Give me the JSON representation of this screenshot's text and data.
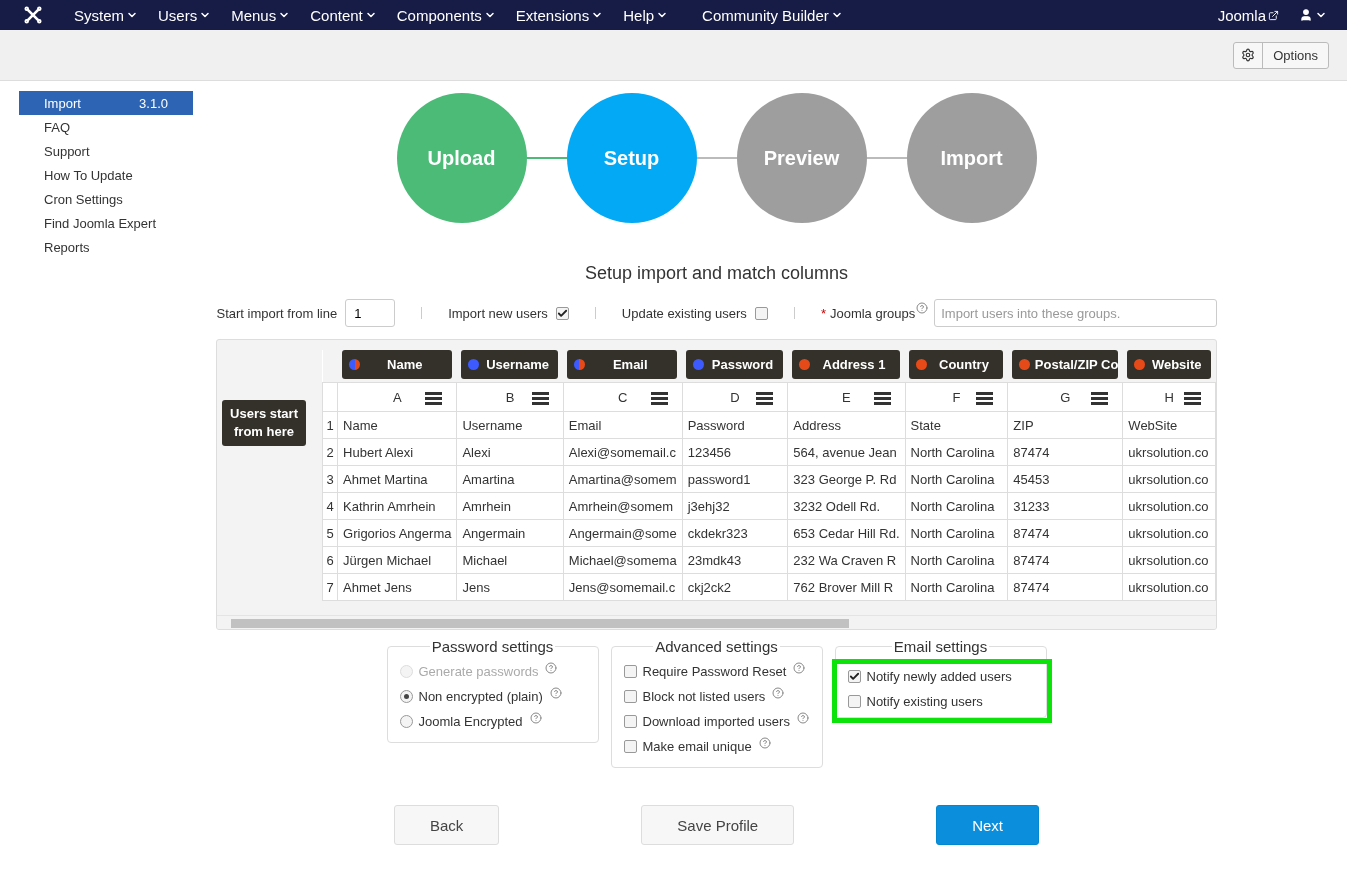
{
  "navbar": {
    "menus": [
      "System",
      "Users",
      "Menus",
      "Content",
      "Components",
      "Extensions",
      "Help",
      "Community Builder"
    ],
    "site_link": "Joomla"
  },
  "toolbar": {
    "options_button": "Options"
  },
  "sidebar": {
    "items": [
      {
        "label": "Import",
        "version": "3.1.0",
        "selected": true
      },
      {
        "label": "FAQ",
        "selected": false
      },
      {
        "label": "Support",
        "selected": false
      },
      {
        "label": "How To Update",
        "selected": false
      },
      {
        "label": "Cron Settings",
        "selected": false
      },
      {
        "label": "Find Joomla Expert",
        "selected": false
      },
      {
        "label": "Reports",
        "selected": false
      }
    ]
  },
  "steps": [
    {
      "label": "Upload",
      "completed": true,
      "selected": false
    },
    {
      "label": "Setup",
      "completed": false,
      "selected": true
    },
    {
      "label": "Preview",
      "completed": false,
      "selected": false
    },
    {
      "label": "Import",
      "completed": false,
      "selected": false
    }
  ],
  "heading": "Setup import and match columns",
  "options": {
    "start_line_label": "Start import from line",
    "start_line_value": "1",
    "import_new_label": "Import new users",
    "import_new_checked": true,
    "update_existing_label": "Update existing users",
    "update_existing_checked": false,
    "groups_required_mark": "*",
    "groups_label": "Joomla groups",
    "groups_placeholder": "Import users into these groups."
  },
  "table": {
    "start_marker": "Users start from here",
    "mappings": [
      {
        "label": "Name",
        "color": "#3d5afe",
        "mixed": true
      },
      {
        "label": "Username",
        "color": "#3d5afe"
      },
      {
        "label": "Email",
        "color": "#3d5afe",
        "mixed": true
      },
      {
        "label": "Password",
        "color": "#3d5afe"
      },
      {
        "label": "Address 1",
        "color": "#e64a19"
      },
      {
        "label": "Country",
        "color": "#e64a19"
      },
      {
        "label": "Postal/ZIP Co",
        "color": "#e64a19"
      },
      {
        "label": "Website",
        "color": "#e64a19"
      }
    ],
    "columns": [
      "A",
      "B",
      "C",
      "D",
      "E",
      "F",
      "G",
      "H"
    ],
    "rows": [
      {
        "number": "1",
        "cells": [
          "Name",
          "Username",
          "Email",
          "Password",
          "Address",
          "State",
          "ZIP",
          "WebSite"
        ]
      },
      {
        "number": "2",
        "cells": [
          "Hubert Alexi",
          "Alexi",
          "Alexi@somemail.c",
          "123456",
          "564, avenue Jean",
          "North Carolina",
          "87474",
          "ukrsolution.co"
        ]
      },
      {
        "number": "3",
        "cells": [
          "Ahmet Martina",
          "Amartina",
          "Amartina@somem",
          "password1",
          "323 George P. Rd",
          "North Carolina",
          "45453",
          "ukrsolution.co"
        ]
      },
      {
        "number": "4",
        "cells": [
          "Kathrin Amrhein",
          "Amrhein",
          "Amrhein@somem",
          "j3ehj32",
          "3232 Odell Rd.",
          "North Carolina",
          "31233",
          "ukrsolution.co"
        ]
      },
      {
        "number": "5",
        "cells": [
          "Grigorios Angerma",
          "Angermain",
          "Angermain@some",
          "ckdekr323",
          "653 Cedar Hill Rd.",
          "North Carolina",
          "87474",
          "ukrsolution.co"
        ]
      },
      {
        "number": "6",
        "cells": [
          "Jürgen Michael",
          "Michael",
          "Michael@somema",
          "23mdk43",
          "232 Wa Craven R",
          "North Carolina",
          "87474",
          "ukrsolution.co"
        ]
      },
      {
        "number": "7",
        "cells": [
          "Ahmet Jens",
          "Jens",
          "Jens@somemail.c",
          "ckj2ck2",
          "762 Brover Mill R",
          "North Carolina",
          "87474",
          "ukrsolution.co"
        ]
      }
    ]
  },
  "settings": [
    {
      "title": "Password settings",
      "highlighted": false,
      "items": [
        {
          "kind": "radio",
          "label": "Generate passwords",
          "selected": false,
          "disabled": true,
          "help": true
        },
        {
          "kind": "radio",
          "label": "Non encrypted (plain)",
          "selected": true,
          "disabled": false,
          "help": true
        },
        {
          "kind": "radio",
          "label": "Joomla Encrypted",
          "selected": false,
          "disabled": false,
          "help": true
        }
      ]
    },
    {
      "title": "Advanced settings",
      "highlighted": false,
      "items": [
        {
          "kind": "checkbox",
          "label": "Require Password Reset",
          "checked": false,
          "help": true
        },
        {
          "kind": "checkbox",
          "label": "Block not listed users",
          "checked": false,
          "help": true
        },
        {
          "kind": "checkbox",
          "label": "Download imported users",
          "checked": false,
          "help": true
        },
        {
          "kind": "checkbox",
          "label": "Make email unique",
          "checked": false,
          "help": true
        }
      ]
    },
    {
      "title": "Email settings",
      "highlighted": true,
      "items": [
        {
          "kind": "checkbox",
          "label": "Notify newly added users",
          "checked": true,
          "help": false
        },
        {
          "kind": "checkbox",
          "label": "Notify existing users",
          "checked": false,
          "help": false
        }
      ]
    }
  ],
  "buttons": [
    {
      "label": "Back",
      "kind": "default"
    },
    {
      "label": "Save Profile",
      "kind": "default"
    },
    {
      "label": "Next",
      "kind": "primary"
    }
  ]
}
